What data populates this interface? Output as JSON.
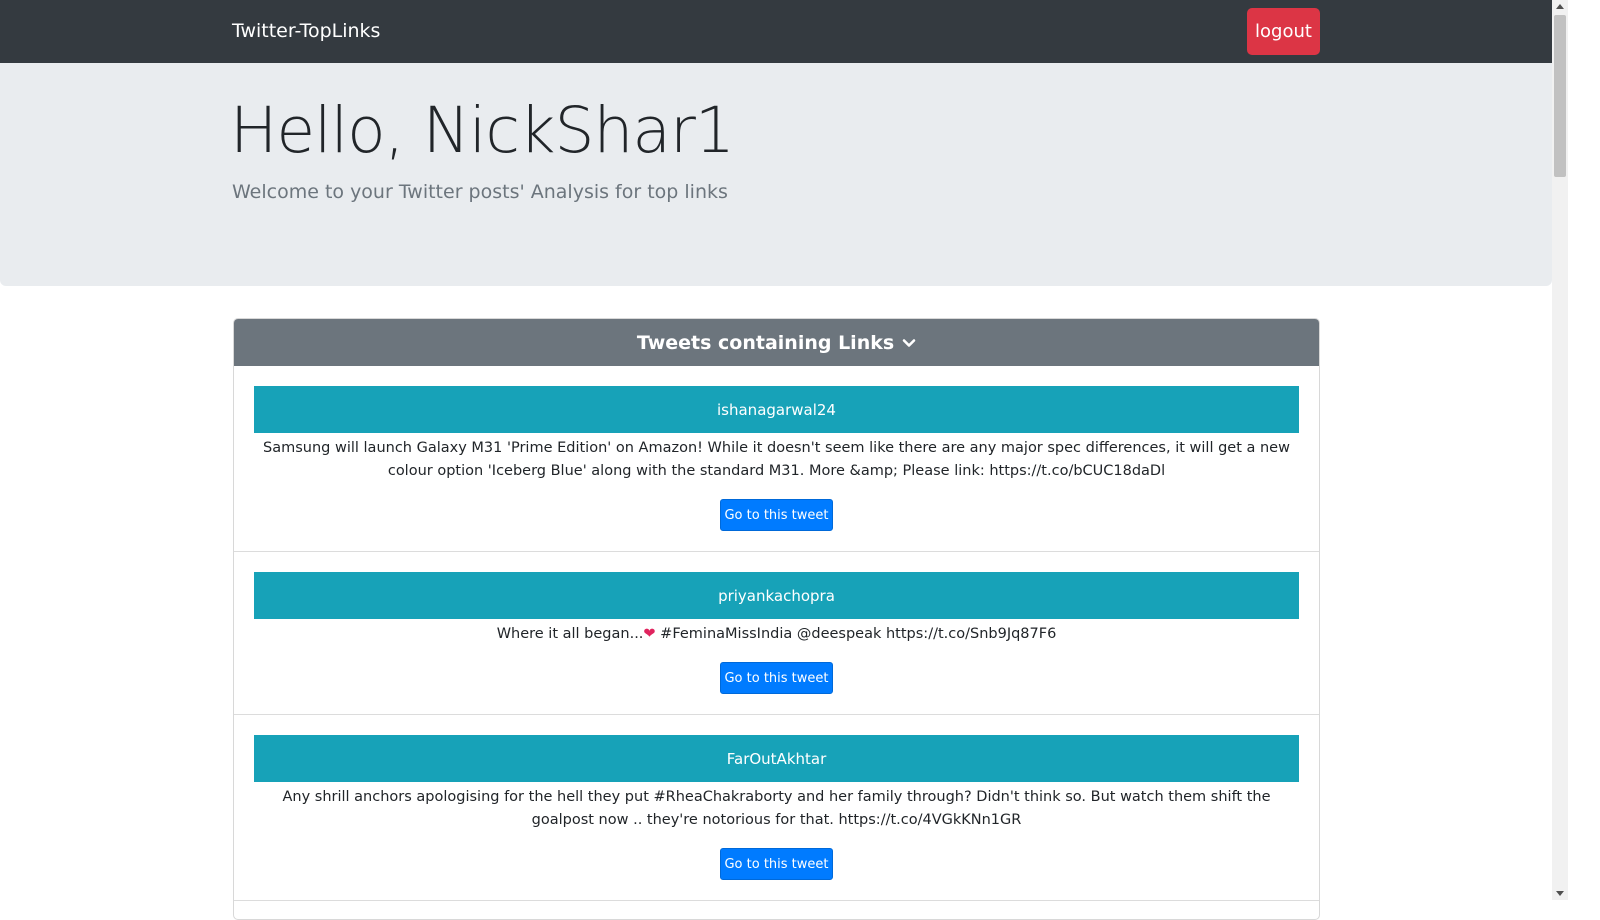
{
  "navbar": {
    "brand": "Twitter-TopLinks",
    "logout_label": "logout"
  },
  "jumbotron": {
    "greeting": "Hello, NickShar1",
    "subtitle": "Welcome to your Twitter posts' Analysis for top links"
  },
  "card": {
    "header": "Tweets containing Links",
    "tweets": [
      {
        "user": "ishanagarwal24",
        "text": "Samsung will launch Galaxy M31 'Prime Edition' on Amazon! While it doesn't seem like there are any major spec differences, it will get a new colour option 'Iceberg Blue' along with the standard M31. More &amp; Please link: https://t.co/bCUC18daDl",
        "button": "Go to this tweet"
      },
      {
        "user": "priyankachopra",
        "text_before": "Where it all began...",
        "emoji": "❤",
        "text_after": " #FeminaMissIndia @deespeak https://t.co/Snb9Jq87F6",
        "button": "Go to this tweet"
      },
      {
        "user": "FarOutAkhtar",
        "text": "Any shrill anchors apologising for the hell they put #RheaChakraborty and her family through? Didn't think so. But watch them shift the goalpost now .. they're notorious for that. https://t.co/4VGkKNn1GR",
        "button": "Go to this tweet"
      }
    ]
  },
  "colors": {
    "navbar": "#343a40",
    "logout": "#dc3545",
    "jumbotron": "#e9ecef",
    "card_header": "#6c757d",
    "tweet_header": "#17a2b8",
    "primary_button": "#007bff"
  }
}
